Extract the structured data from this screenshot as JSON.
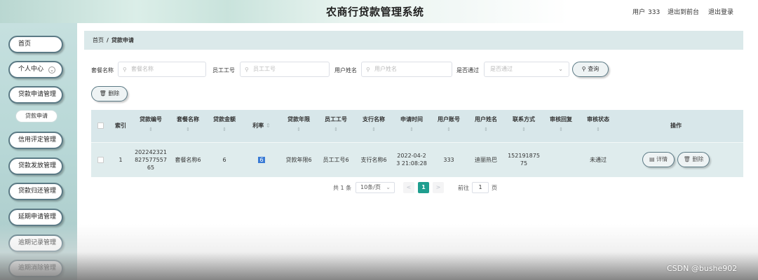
{
  "header": {
    "title": "农商行贷款管理系统",
    "user_label": "用户",
    "user_name": "333",
    "exit_front": "退出到前台",
    "logout": "退出登录"
  },
  "sidebar": {
    "items": [
      {
        "label": "首页"
      },
      {
        "label": "个人中心"
      },
      {
        "label": "贷款申请管理"
      },
      {
        "label": "贷款申请"
      },
      {
        "label": "信用评定管理"
      },
      {
        "label": "贷款发放管理"
      },
      {
        "label": "贷款归还管理"
      },
      {
        "label": "延期申请管理"
      },
      {
        "label": "逾期记录管理"
      },
      {
        "label": "逾期消除管理"
      }
    ]
  },
  "breadcrumb": {
    "home": "首页",
    "sep": "/",
    "current": "贷款申请"
  },
  "search": {
    "package_label": "套餐名称",
    "package_placeholder": "套餐名称",
    "employee_label": "员工工号",
    "employee_placeholder": "员工工号",
    "username_label": "用户姓名",
    "username_placeholder": "用户姓名",
    "passed_label": "是否通过",
    "passed_placeholder": "是否通过",
    "query_button": "查询",
    "delete_button": "删除"
  },
  "table": {
    "headers": {
      "index": "索引",
      "loan_no": "贷款编号",
      "package": "套餐名称",
      "amount": "贷款金额",
      "rate": "利率",
      "term": "贷款年限",
      "employee": "员工工号",
      "branch": "支行名称",
      "apply_time": "申请时间",
      "account": "用户账号",
      "username": "用户姓名",
      "contact": "联系方式",
      "review_reply": "审核回复",
      "review_status": "审核状态",
      "ops": "操作"
    },
    "sort_glyph": "⇕",
    "rows": [
      {
        "index": "1",
        "loan_no_1": "202242321",
        "loan_no_2": "827577557",
        "loan_no_3": "65",
        "package": "套餐名称6",
        "amount": "6",
        "rate": "6",
        "term": "贷款年限6",
        "employee": "员工工号6",
        "branch": "支行名称6",
        "apply_time_1": "2022-04-2",
        "apply_time_2": "3 21:08:28",
        "account": "333",
        "username": "迪丽热巴",
        "contact_1": "152191875",
        "contact_2": "75",
        "review_reply": "",
        "review_status": "未通过",
        "detail_button": "详情",
        "delete_button": "删除"
      }
    ]
  },
  "pagination": {
    "total": "共 1 条",
    "page_size": "10条/页",
    "prev": "<",
    "current_page": "1",
    "next": ">",
    "goto_label": "前往",
    "goto_value": "1",
    "page_word": "页"
  },
  "watermark": "CSDN @bushe902",
  "colors": {
    "accent": "#1f9e8f",
    "sidebar_bg": "#b7d7d6",
    "table_header_bg": "#d8e7ea",
    "pill_border": "#5b7a85",
    "selection": "#3a7bd5"
  }
}
